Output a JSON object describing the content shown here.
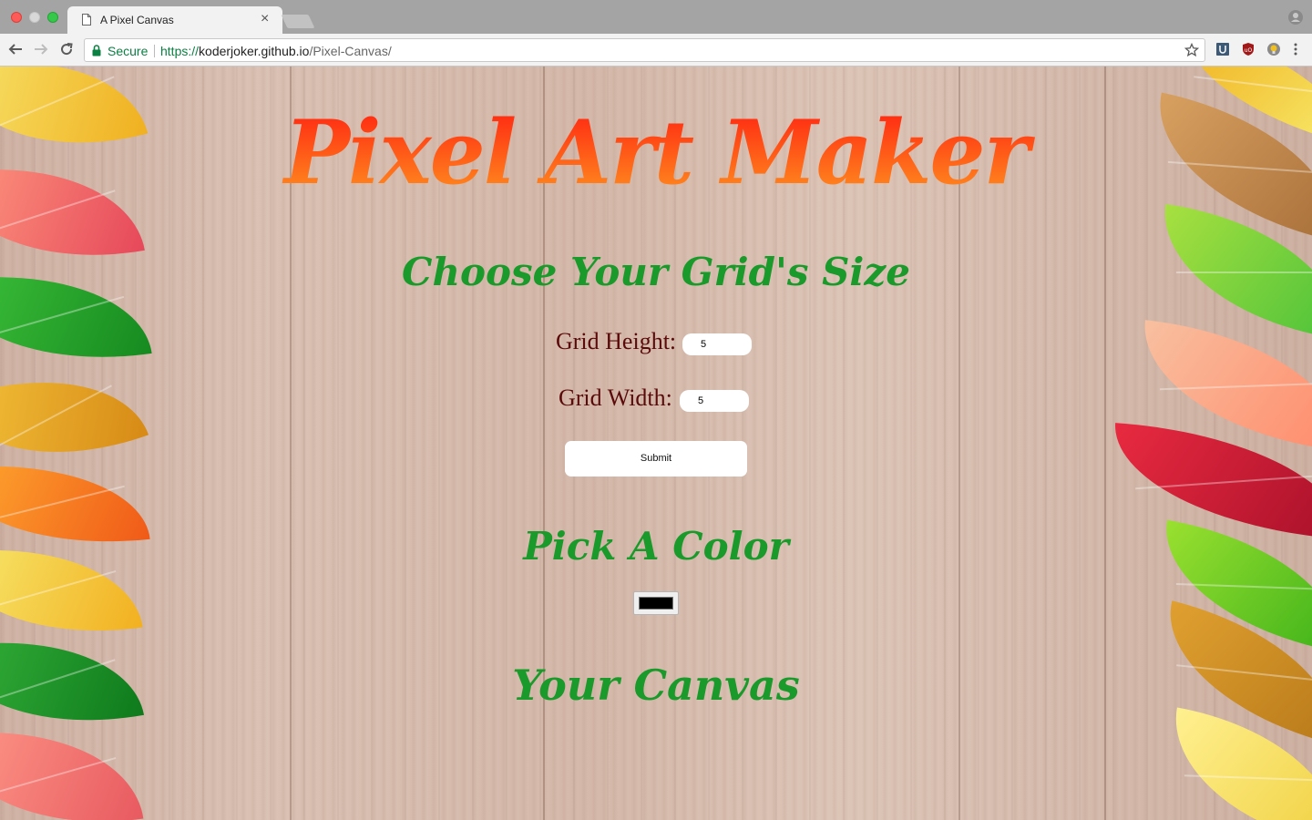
{
  "browser": {
    "tab_title": "A Pixel Canvas",
    "tab_close": "×",
    "secure_label": "Secure",
    "url_scheme": "https://",
    "url_host": "koderjoker.github.io",
    "url_path": "/Pixel-Canvas/"
  },
  "page": {
    "title": "Pixel Art Maker",
    "grid_heading": "Choose Your Grid's Size",
    "height_label": "Grid Height:",
    "height_value": "5",
    "width_label": "Grid Width:",
    "width_value": "5",
    "submit_label": "Submit",
    "color_heading": "Pick A Color",
    "selected_color": "#000000",
    "canvas_heading": "Your Canvas"
  },
  "colors": {
    "title_gradient_top": "#ff2a12",
    "title_gradient_bottom": "#ff8a1e",
    "heading_green": "#1a9a2a",
    "label_maroon": "#5a0a0a",
    "secure_green": "#0b8043"
  }
}
